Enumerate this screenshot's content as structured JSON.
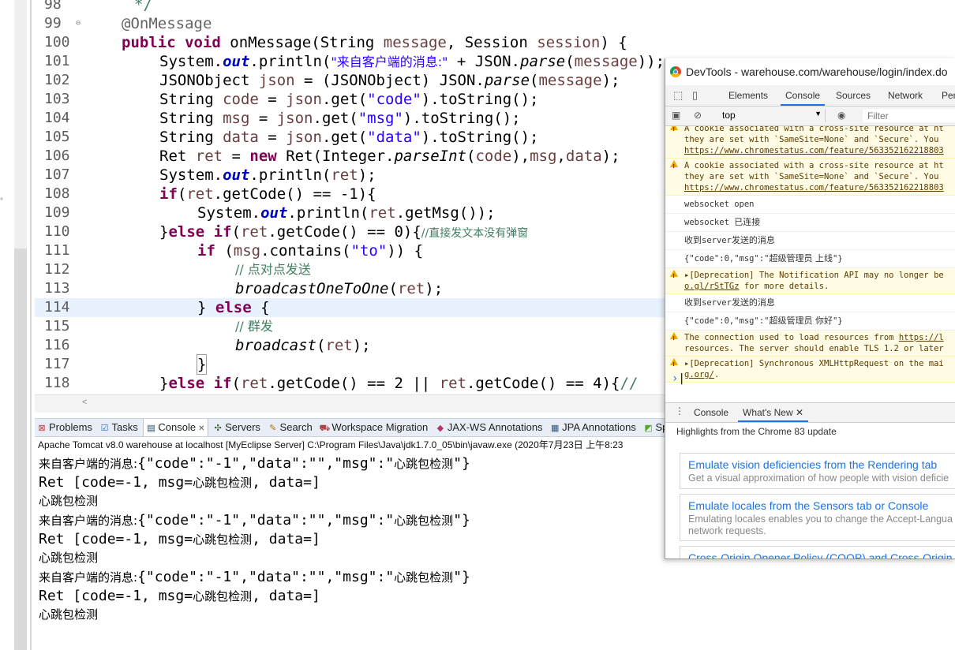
{
  "editor": {
    "lines": [
      {
        "n": "98"
      },
      {
        "n": "99"
      },
      {
        "n": "100"
      },
      {
        "n": "101"
      },
      {
        "n": "102"
      },
      {
        "n": "103"
      },
      {
        "n": "104"
      },
      {
        "n": "105"
      },
      {
        "n": "106"
      },
      {
        "n": "107"
      },
      {
        "n": "108"
      },
      {
        "n": "109"
      },
      {
        "n": "110"
      },
      {
        "n": "111"
      },
      {
        "n": "112"
      },
      {
        "n": "113"
      },
      {
        "n": "114"
      },
      {
        "n": "115"
      },
      {
        "n": "116"
      },
      {
        "n": "117"
      },
      {
        "n": "118"
      }
    ],
    "tokens": {
      "l98": "*/",
      "l99": "@OnMessage",
      "l100_kw1": "public",
      "l100_kw2": "void",
      "l100_a": " onMessage(String ",
      "l100_v1": "message",
      "l100_b": ", Session ",
      "l100_v2": "session",
      "l100_c": ") {",
      "l101_a": "System.",
      "l101_f": "out",
      "l101_b": ".println(",
      "l101_s": "\"来自客户端的消息:\"",
      "l101_c": " + JSON.",
      "l101_i": "parse",
      "l101_d": "(",
      "l101_v": "message",
      "l101_e": "));",
      "l102_a": "JSONObject ",
      "l102_v": "json",
      "l102_b": " = (JSONObject) JSON.",
      "l102_i": "parse",
      "l102_c": "(",
      "l102_v2": "message",
      "l102_d": ");",
      "l103_a": "String ",
      "l103_v": "code",
      "l103_b": " = ",
      "l103_v2": "json",
      "l103_c": ".get(",
      "l103_s": "\"code\"",
      "l103_d": ").toString();",
      "l104_a": "String ",
      "l104_v": "msg",
      "l104_b": " = ",
      "l104_v2": "json",
      "l104_c": ".get(",
      "l104_s": "\"msg\"",
      "l104_d": ").toString();",
      "l105_a": "String ",
      "l105_v": "data",
      "l105_b": " = ",
      "l105_v2": "json",
      "l105_c": ".get(",
      "l105_s": "\"data\"",
      "l105_d": ").toString();",
      "l106_a": "Ret ",
      "l106_v": "ret",
      "l106_b": " = ",
      "l106_kw": "new",
      "l106_c": " Ret(Integer.",
      "l106_i": "parseInt",
      "l106_d": "(",
      "l106_v2": "code",
      "l106_e": "),",
      "l106_v3": "msg",
      "l106_f": ",",
      "l106_v4": "data",
      "l106_g": ");",
      "l107_a": "System.",
      "l107_f": "out",
      "l107_b": ".println(",
      "l107_v": "ret",
      "l107_c": ");",
      "l108_kw": "if",
      "l108_a": "(",
      "l108_v": "ret",
      "l108_b": ".getCode() == -1){",
      "l109_a": "System.",
      "l109_f": "out",
      "l109_b": ".println(",
      "l109_v": "ret",
      "l109_c": ".getMsg());",
      "l110_a": "}",
      "l110_kw": "else if",
      "l110_b": "(",
      "l110_v": "ret",
      "l110_c": ".getCode() == 0){",
      "l110_cm": "//直接发文本没有弹窗",
      "l111_kw": "if",
      "l111_a": " (",
      "l111_v": "msg",
      "l111_b": ".contains(",
      "l111_s": "\"to\"",
      "l111_c": ")) {",
      "l112_cm": "// 点对点发送",
      "l113_i": "broadcastOneToOne",
      "l113_a": "(",
      "l113_v": "ret",
      "l113_b": ");",
      "l114_a": "} ",
      "l114_kw": "else",
      "l114_b": " {",
      "l115_cm": "// 群发",
      "l116_i": "broadcast",
      "l116_a": "(",
      "l116_v": "ret",
      "l116_b": ");",
      "l117": "}",
      "l118_a": "}",
      "l118_kw": "else if",
      "l118_b": "(",
      "l118_v": "ret",
      "l118_c": ".getCode() == 2 || ",
      "l118_v2": "ret",
      "l118_d": ".getCode() == 4){",
      "l118_cm": "//"
    }
  },
  "views": {
    "tabs": [
      {
        "label": "Problems"
      },
      {
        "label": "Tasks"
      },
      {
        "label": "Console"
      },
      {
        "label": "Servers"
      },
      {
        "label": "Search"
      },
      {
        "label": "Workspace Migration"
      },
      {
        "label": "JAX-WS Annotations"
      },
      {
        "label": "JPA Annotations"
      },
      {
        "label": "Sprin"
      }
    ],
    "console_desc": "Apache Tomcat v8.0 warehouse at localhost [MyEclipse Server] C:\\Program Files\\Java\\jdk1.7.0_05\\bin\\javaw.exe (2020年7月23日 上午8:23",
    "output": {
      "a1_pre": "来自客户端的消息:",
      "a1_json": "{\"code\":\"-1\",\"data\":\"\",\"msg\":\"",
      "a1_cn": "心跳包检测",
      "a1_end": "\"}",
      "b1_pre": "Ret [code=-1, msg=",
      "b1_cn": "心跳包检测",
      "b1_end": ", data=]",
      "c1": "心跳包检测",
      "a2_pre": "来自客户端的消息:",
      "a2_json": "{\"code\":\"-1\",\"data\":\"\",\"msg\":\"",
      "a2_cn": "心跳包检测",
      "a2_end": "\"}",
      "b2_pre": "Ret [code=-1, msg=",
      "b2_cn": "心跳包检测",
      "b2_end": ", data=]",
      "c2": "心跳包检测",
      "a3_pre": "来自客户端的消息:",
      "a3_json": "{\"code\":\"-1\",\"data\":\"\",\"msg\":\"",
      "a3_cn": "心跳包检测",
      "a3_end": "\"}",
      "b3_pre": "Ret [code=-1, msg=",
      "b3_cn": "心跳包检测",
      "b3_end": ", data=]",
      "c3": "心跳包检测"
    }
  },
  "devtools": {
    "title": "DevTools - warehouse.com/warehouse/login/index.do",
    "tabs": {
      "elements": "Elements",
      "console": "Console",
      "sources": "Sources",
      "network": "Network",
      "perf": "Per"
    },
    "context": "top",
    "filter_placeholder": "Filter",
    "messages": {
      "w1a": "A cookie associated with a cross-site resource at ht",
      "w1b": "they are set with `SameSite=None` and `Secure`. You",
      "w1c": "https://www.chromestatus.com/feature/563352162218803",
      "w2a": "A cookie associated with a cross-site resource at ht",
      "w2b": "they are set with `SameSite=None` and `Secure`. You",
      "w2c": "https://www.chromestatus.com/feature/563352162218803",
      "m1": "websocket open",
      "m2_a": "websocket ",
      "m2_b": "已连接",
      "m3_a": "收到",
      "m3_b": "server",
      "m3_c": "发送的消息",
      "m4_a": "{\"code\":0,\"msg\":\"",
      "m4_b": "超级管理员 上线",
      "m4_c": "\"}",
      "w3a": "▸[Deprecation] The Notification API may no longer be",
      "w3b_link": "o.gl/rStTGz",
      "w3b_rest": " for more details.",
      "m5_a": "收到",
      "m5_b": "server",
      "m5_c": "发送的消息",
      "m6_a": "{\"code\":0,\"msg\":\"",
      "m6_b": "超级管理员 你好",
      "m6_c": "\"}",
      "w4a_pre": "The connection used to load resources from ",
      "w4a_link": "https://l",
      "w4b": "resources. The server should enable TLS 1.2 or later",
      "w5a": "▸[Deprecation] Synchronous XMLHttpRequest on the mai",
      "w5b_link": "g.org/",
      "w5b_rest": "."
    },
    "drawer": {
      "console": "Console",
      "whats_new": "What's New"
    },
    "highlights": "Highlights from the Chrome 83 update",
    "cards": [
      {
        "title": "Emulate vision deficiencies from the Rendering tab",
        "desc": "Get a visual approximation of how people with vision deficie"
      },
      {
        "title": "Emulate locales from the Sensors tab or Console",
        "desc": "Emulating locales enables you to change the Accept-Langua",
        "desc2": "network requests."
      },
      {
        "title": "Cross-Origin Opener Policy (COOP) and Cross-Origin Em",
        "desc": ""
      }
    ]
  }
}
